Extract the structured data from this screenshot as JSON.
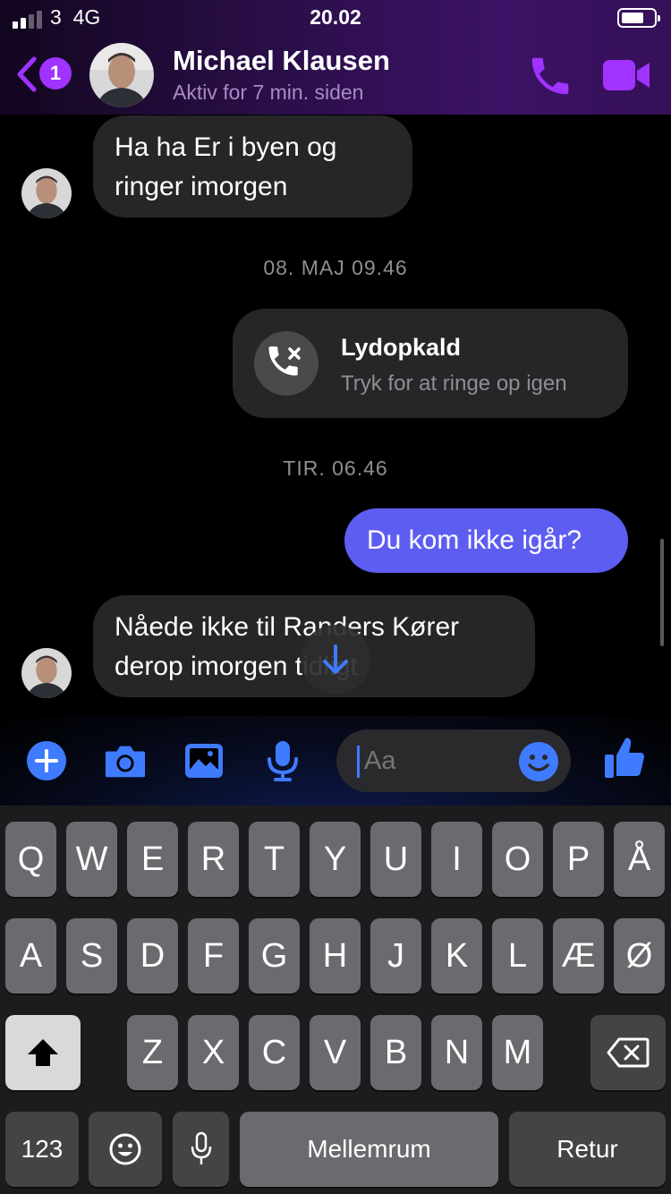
{
  "status_bar": {
    "carrier": "3",
    "network": "4G",
    "time": "20.02"
  },
  "header": {
    "unread_count": "1",
    "contact_name": "Michael Klausen",
    "contact_status": "Aktiv for 7 min. siden",
    "accent_color": "#a033ff"
  },
  "conversation": {
    "msg1_line1": "Ha ha    Er i byen og",
    "msg1_line2": "ringer imorgen",
    "timestamp1": "08. MAJ 09.46",
    "call_title": "Lydopkald",
    "call_subtitle": "Tryk for at ringe op igen",
    "timestamp2": "TIR. 06.46",
    "msg2": "Du kom ikke igår?",
    "msg3_line1": "Nåede ikke til Randers  Kører",
    "msg3_line2": "derop imorgen tidligt",
    "outgoing_color": "#5e5df2",
    "incoming_color": "#262628"
  },
  "composer": {
    "placeholder": "Aa",
    "icons": [
      "plus-icon",
      "camera-icon",
      "gallery-icon",
      "microphone-icon",
      "emoji-icon",
      "thumbs-up-icon"
    ],
    "icon_color": "#3f7bff"
  },
  "keyboard": {
    "row1": [
      "Q",
      "W",
      "E",
      "R",
      "T",
      "Y",
      "U",
      "I",
      "O",
      "P",
      "Å"
    ],
    "row2": [
      "A",
      "S",
      "D",
      "F",
      "G",
      "H",
      "J",
      "K",
      "L",
      "Æ",
      "Ø"
    ],
    "row3": [
      "Z",
      "X",
      "C",
      "V",
      "B",
      "N",
      "M"
    ],
    "numbers_key": "123",
    "space_key": "Mellemrum",
    "return_key": "Retur"
  }
}
